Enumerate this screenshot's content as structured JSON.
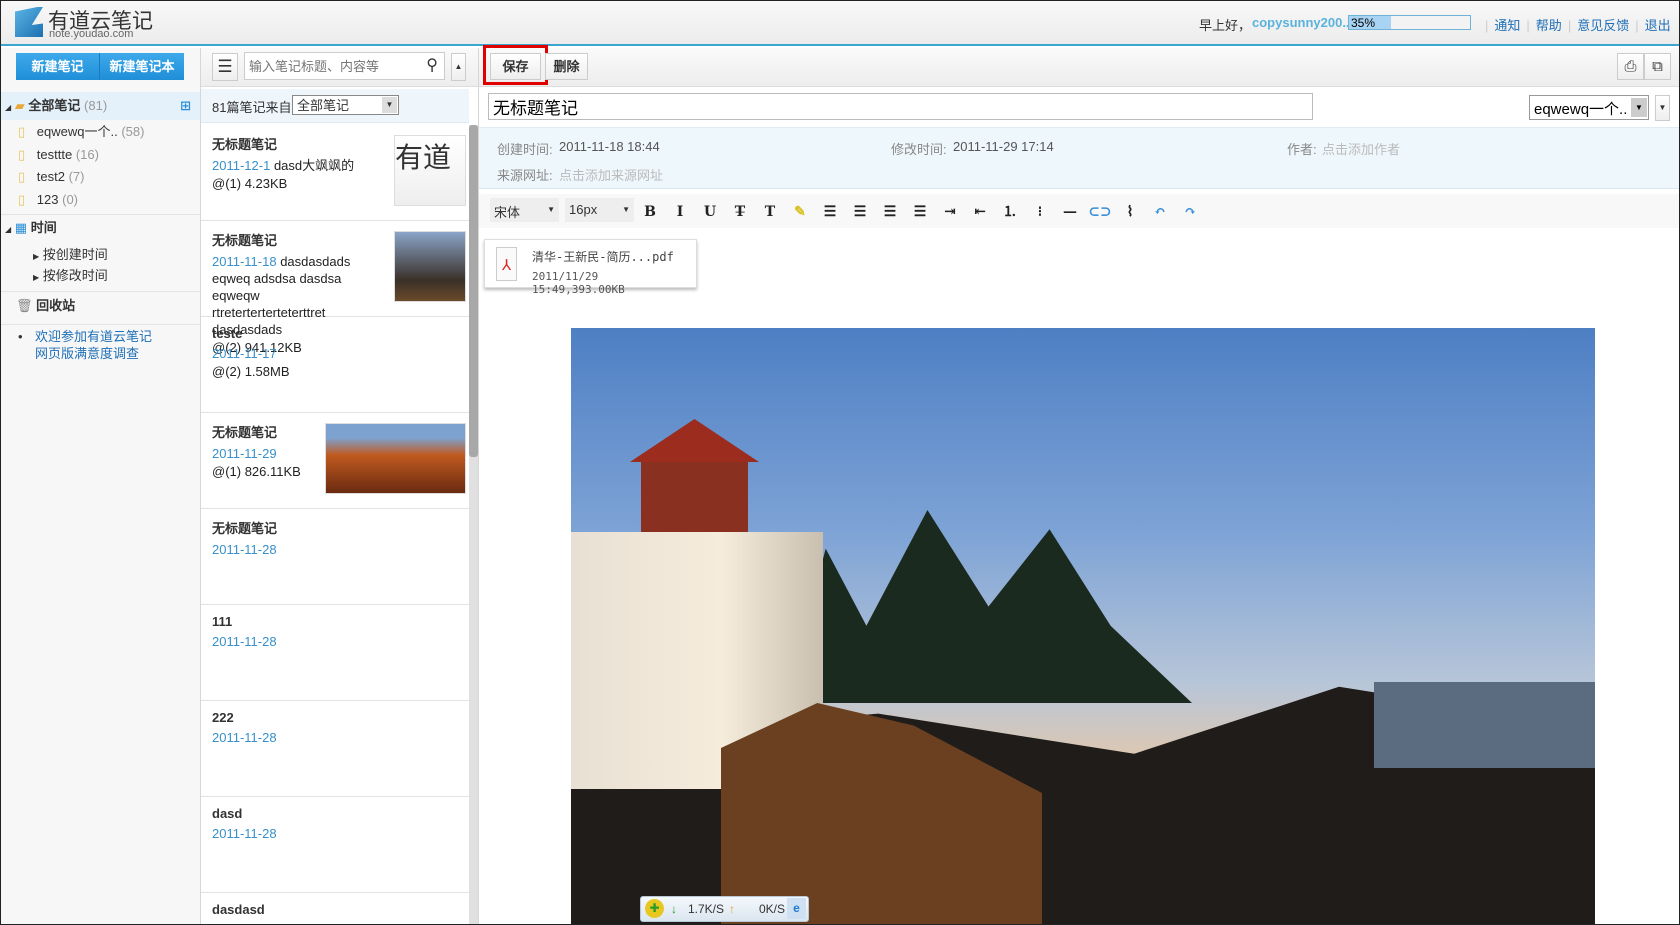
{
  "header": {
    "logo_title": "有道云笔记",
    "logo_sub": "note.youdao.com",
    "greeting": "早上好，",
    "username": "copysunny200...",
    "storage_percent": 35,
    "storage_label": "35%",
    "links": [
      "通知",
      "帮助",
      "意见反馈",
      "退出"
    ]
  },
  "sidebar": {
    "new_note": "新建笔记",
    "new_notebook": "新建笔记本",
    "all_notes": "全部笔记",
    "all_count": "(81)",
    "notebooks": [
      {
        "name": "eqwewq一个..",
        "count": "(58)"
      },
      {
        "name": "testtte",
        "count": "(16)"
      },
      {
        "name": "test2",
        "count": "(7)"
      },
      {
        "name": "123",
        "count": "(0)"
      }
    ],
    "time": "时间",
    "by_created": "按创建时间",
    "by_modified": "按修改时间",
    "trash": "回收站",
    "survey_line1": "欢迎参加有道云笔记",
    "survey_line2": "网页版满意度调查"
  },
  "list": {
    "search_placeholder": "输入笔记标题、内容等",
    "count_label": "81篇笔记来自",
    "filter": "全部笔记",
    "notes": [
      {
        "title": "无标题笔记",
        "date": "2011-12-1",
        "snippet": "dasd大飒飒的",
        "meta": "@(1) 4.23KB"
      },
      {
        "title": "无标题笔记",
        "date": "2011-11-18",
        "snippet": "dasdasdads eqweq adsdsa dasdsa eqweqw rtreterterterteterttret dasdasdads",
        "meta": "@(2) 941.12KB"
      },
      {
        "title": "teste",
        "date": "2011-11-17",
        "snippet": "",
        "meta": "@(2) 1.58MB"
      },
      {
        "title": "无标题笔记",
        "date": "2011-11-29",
        "snippet": "",
        "meta": "@(1) 826.11KB"
      },
      {
        "title": "无标题笔记",
        "date": "2011-11-28",
        "snippet": "",
        "meta": ""
      },
      {
        "title": "111",
        "date": "2011-11-28",
        "snippet": "",
        "meta": ""
      },
      {
        "title": "222",
        "date": "2011-11-28",
        "snippet": "",
        "meta": ""
      },
      {
        "title": "dasd",
        "date": "2011-11-28",
        "snippet": "",
        "meta": ""
      },
      {
        "title": "dasdasd",
        "date": "",
        "snippet": "",
        "meta": ""
      }
    ]
  },
  "editor": {
    "save": "保存",
    "delete": "删除",
    "title": "无标题笔记",
    "notebook": "eqwewq一个..",
    "created_label": "创建时间:",
    "created": "2011-11-18 18:44",
    "modified_label": "修改时间:",
    "modified": "2011-11-29 17:14",
    "author_label": "作者:",
    "author_placeholder": "点击添加作者",
    "source_label": "来源网址:",
    "source_placeholder": "点击添加来源网址",
    "font": "宋体",
    "size": "16px",
    "attachment": {
      "name": "清华-王新民-简历...pdf",
      "info": "2011/11/29 15:49,393.00KB"
    }
  },
  "netbar": {
    "down": "1.7K/S",
    "up": "0K/S"
  }
}
